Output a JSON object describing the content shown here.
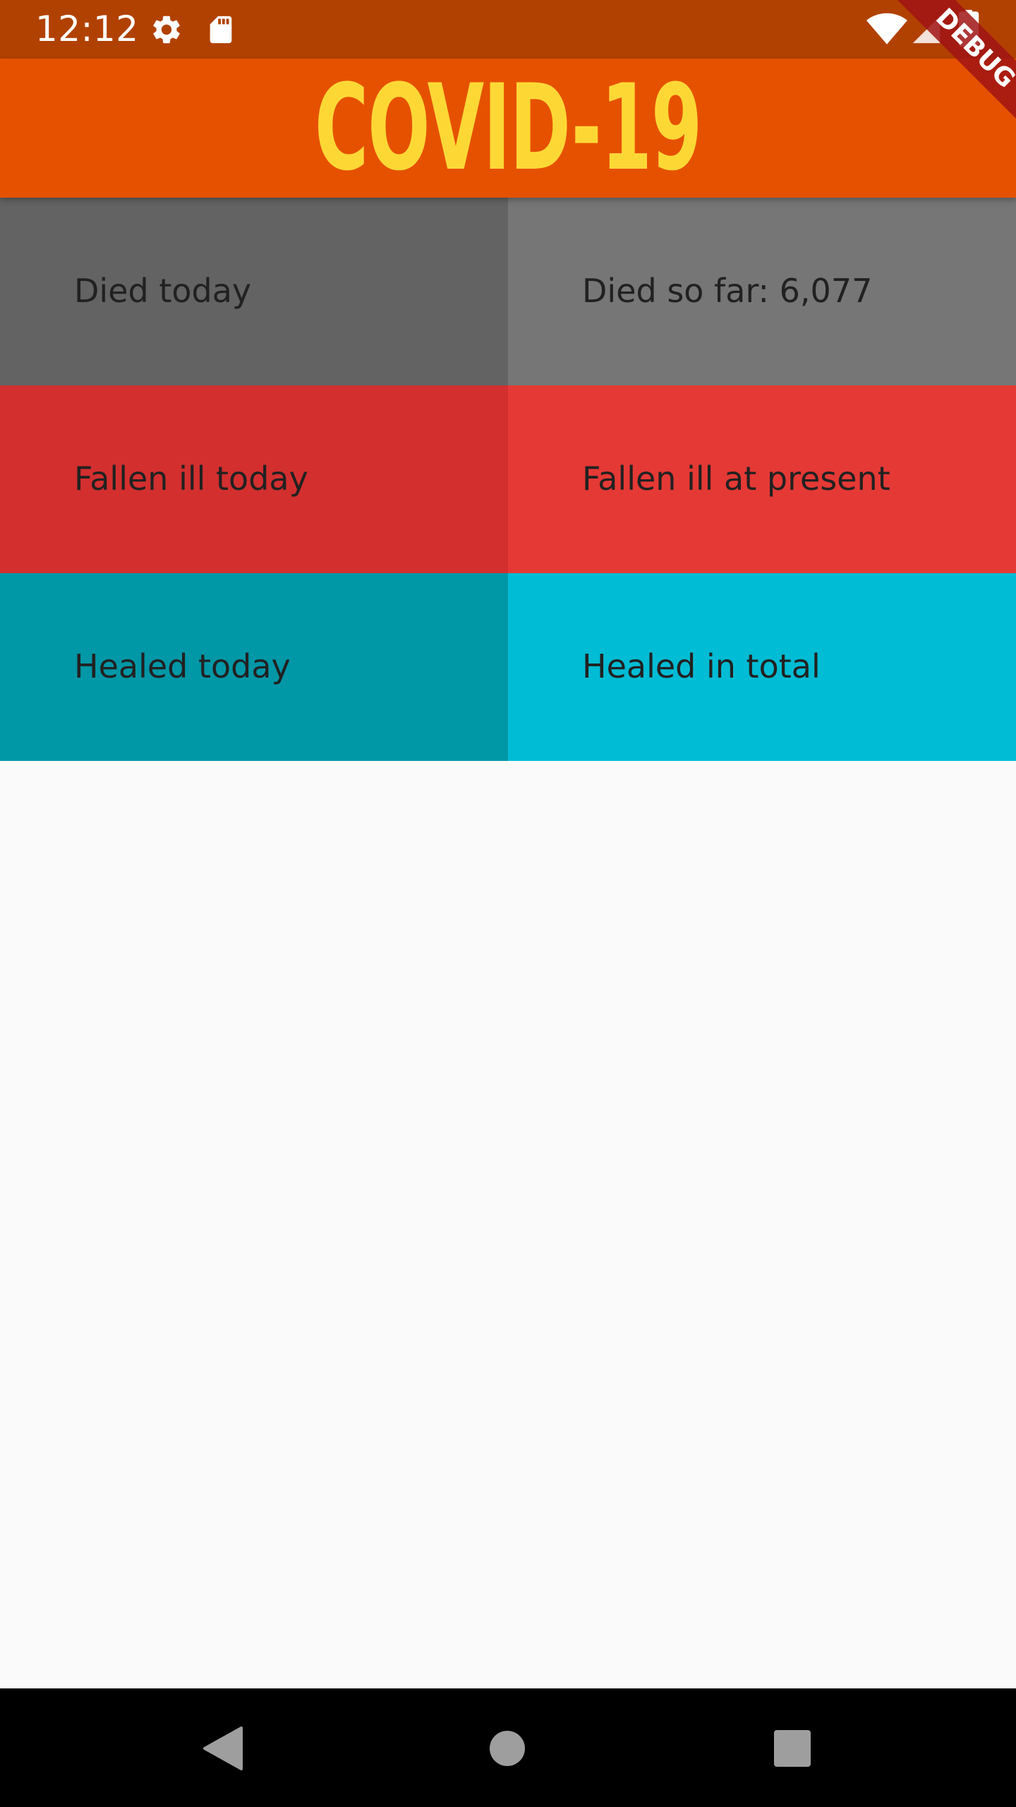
{
  "status_bar": {
    "time": "12:12",
    "icons_left": [
      "gear-icon",
      "sd-card-icon"
    ],
    "icons_right": [
      "wifi-icon",
      "cell-signal-icon",
      "battery-icon"
    ]
  },
  "app_bar": {
    "title": "COVID-19"
  },
  "debug_banner": {
    "label": "DEBUG"
  },
  "stats": {
    "rows": [
      {
        "left": {
          "label": "Died today",
          "color": "#636363"
        },
        "right": {
          "label": "Died so far: 6,077",
          "color": "#767676"
        }
      },
      {
        "left": {
          "label": "Fallen ill today",
          "color": "#d32f2f"
        },
        "right": {
          "label": "Fallen ill at present",
          "color": "#e53935"
        }
      },
      {
        "left": {
          "label": "Healed today",
          "color": "#0097a7"
        },
        "right": {
          "label": "Healed in total",
          "color": "#00bcd4"
        }
      }
    ]
  },
  "nav_bar": {
    "buttons": [
      "back-icon",
      "home-icon",
      "recents-icon"
    ]
  },
  "colors": {
    "status_bar": "#b14100",
    "app_bar": "#e65100",
    "title": "#fdd835",
    "background": "#fafafa"
  }
}
